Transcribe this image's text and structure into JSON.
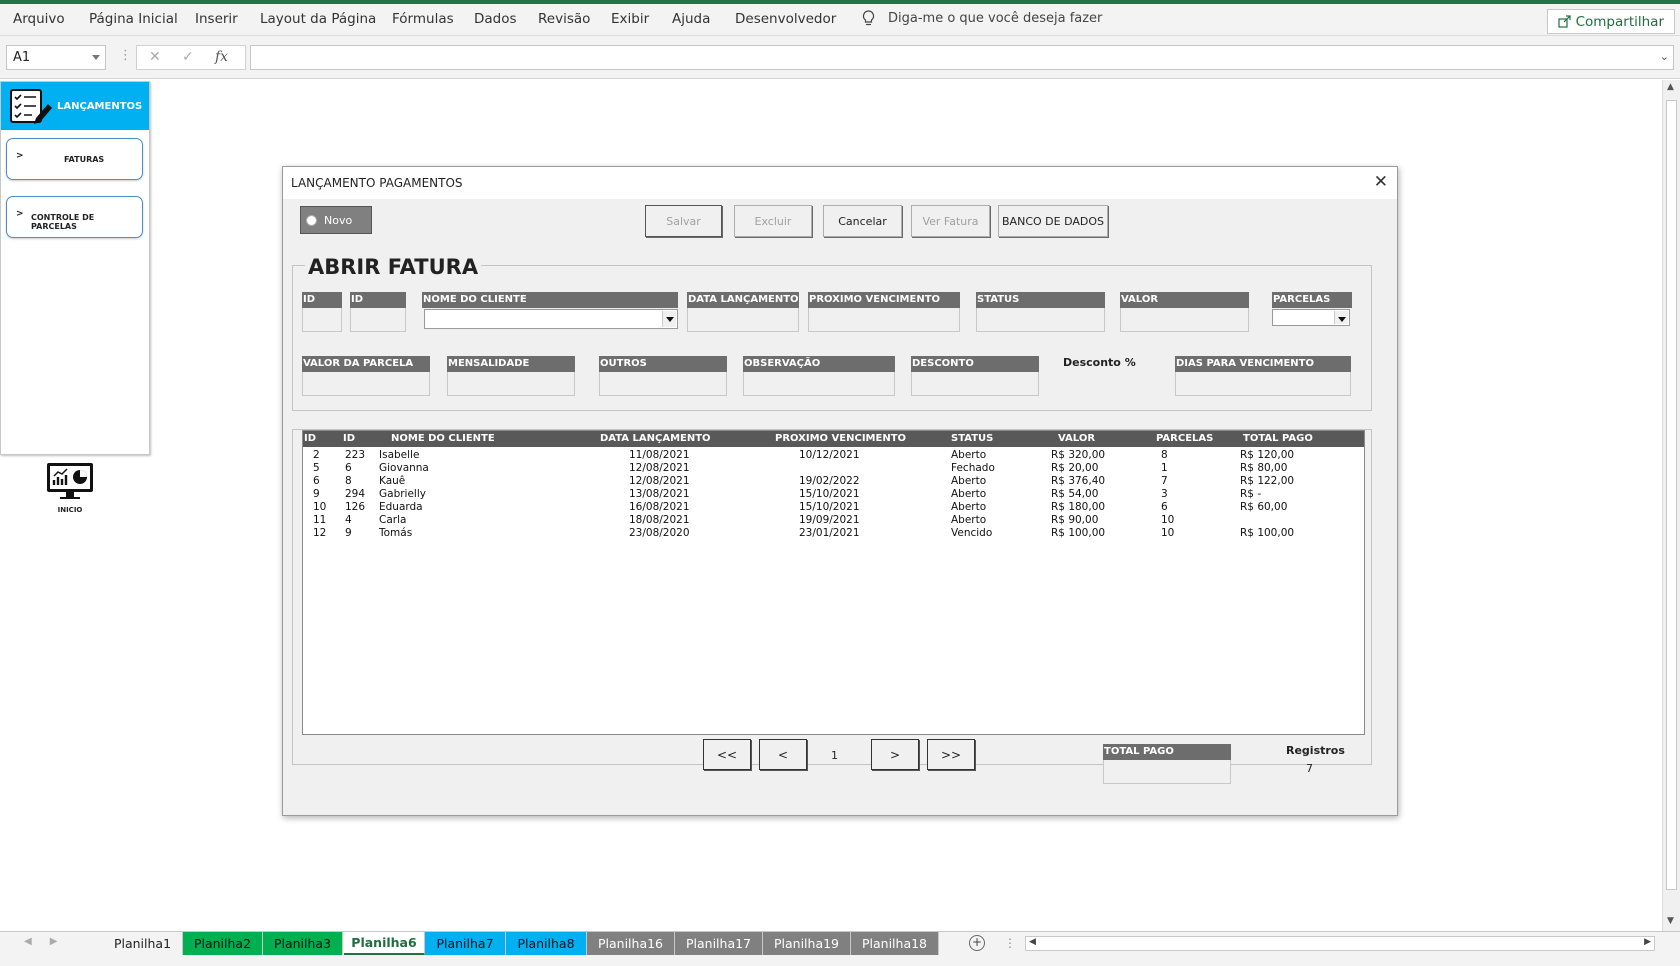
{
  "ribbon": {
    "tabs": [
      "Arquivo",
      "Página Inicial",
      "Inserir",
      "Layout da Página",
      "Fórmulas",
      "Dados",
      "Revisão",
      "Exibir",
      "Ajuda",
      "Desenvolvedor"
    ],
    "tell_me": "Diga-me o que você deseja fazer",
    "share": "Compartilhar"
  },
  "formula_bar": {
    "name_box": "A1",
    "fx": "fx",
    "cancel": "✕",
    "enter": "✓"
  },
  "menu": {
    "title": "LANÇAMENTOS",
    "items": [
      {
        "chevron": ">",
        "label": "FATURAS"
      },
      {
        "chevron": ">",
        "label": "CONTROLE DE PARCELAS"
      }
    ],
    "home_label": "INICIO"
  },
  "dialog": {
    "title": "LANÇAMENTO PAGAMENTOS",
    "close": "✕",
    "new_option": "Novo",
    "buttons": {
      "save": "Salvar",
      "delete": "Excluir",
      "cancel": "Cancelar",
      "view": "Ver Fatura",
      "db": "BANCO DE DADOS"
    },
    "frame_title": "ABRIR FATURA",
    "fields": {
      "id1": "ID",
      "id2": "ID",
      "client": "NOME DO CLIENTE",
      "date": "DATA LANÇAMENTO",
      "next_due": "PROXIMO VENCIMENTO",
      "status": "STATUS",
      "value": "VALOR",
      "installments": "PARCELAS",
      "installment_value": "VALOR DA PARCELA",
      "monthly": "MENSALIDADE",
      "others": "OUTROS",
      "notes": "OBSERVAÇÃO",
      "discount": "DESCONTO",
      "discount_pct": "Desconto %",
      "days_due": "DIAS PARA VENCIMENTO"
    },
    "list": {
      "columns": [
        "ID",
        "ID",
        "NOME DO CLIENTE",
        "DATA LANÇAMENTO",
        "PROXIMO VENCIMENTO",
        "STATUS",
        "VALOR",
        "PARCELAS",
        "TOTAL PAGO"
      ],
      "rows": [
        [
          "2",
          "223",
          "Isabelle",
          "11/08/2021",
          "10/12/2021",
          "Aberto",
          "R$ 320,00",
          "8",
          "R$ 120,00"
        ],
        [
          "5",
          "6",
          "Giovanna",
          "12/08/2021",
          "",
          "Fechado",
          "R$ 20,00",
          "1",
          "R$ 80,00"
        ],
        [
          "6",
          "8",
          "Kauê",
          "12/08/2021",
          "19/02/2022",
          "Aberto",
          "R$ 376,40",
          "7",
          "R$ 122,00"
        ],
        [
          "9",
          "294",
          "Gabrielly",
          "13/08/2021",
          "15/10/2021",
          "Aberto",
          "R$ 54,00",
          "3",
          "R$ -"
        ],
        [
          "10",
          "126",
          "Eduarda",
          "16/08/2021",
          "15/10/2021",
          "Aberto",
          "R$ 180,00",
          "6",
          "R$ 60,00"
        ],
        [
          "11",
          "4",
          "Carla",
          "18/08/2021",
          "19/09/2021",
          "Aberto",
          "R$ 90,00",
          "10",
          ""
        ],
        [
          "12",
          "9",
          "Tomás",
          "23/08/2020",
          "23/01/2021",
          "Vencido",
          "R$ 100,00",
          "10",
          "R$ 100,00"
        ]
      ]
    },
    "nav": {
      "first": "<<",
      "prev": "<",
      "page": "1",
      "next": ">",
      "last": ">>"
    },
    "total_paid_label": "TOTAL PAGO",
    "records_label": "Registros",
    "records_count": "7"
  },
  "sheet_tabs": [
    {
      "name": "Planilha1",
      "color": ""
    },
    {
      "name": "Planilha2",
      "color": "#00b050"
    },
    {
      "name": "Planilha3",
      "color": "#00b050"
    },
    {
      "name": "Planilha6",
      "color": "",
      "active": true
    },
    {
      "name": "Planilha7",
      "color": "#00b0f0"
    },
    {
      "name": "Planilha8",
      "color": "#00b0f0"
    },
    {
      "name": "Planilha16",
      "color": "#808080"
    },
    {
      "name": "Planilha17",
      "color": "#808080"
    },
    {
      "name": "Planilha19",
      "color": "#808080"
    },
    {
      "name": "Planilha18",
      "color": "#808080"
    }
  ],
  "colors": {
    "accent": "#217346",
    "menu_header": "#00b0f0",
    "field_label": "#6d6d6d",
    "list_header": "#595959"
  }
}
